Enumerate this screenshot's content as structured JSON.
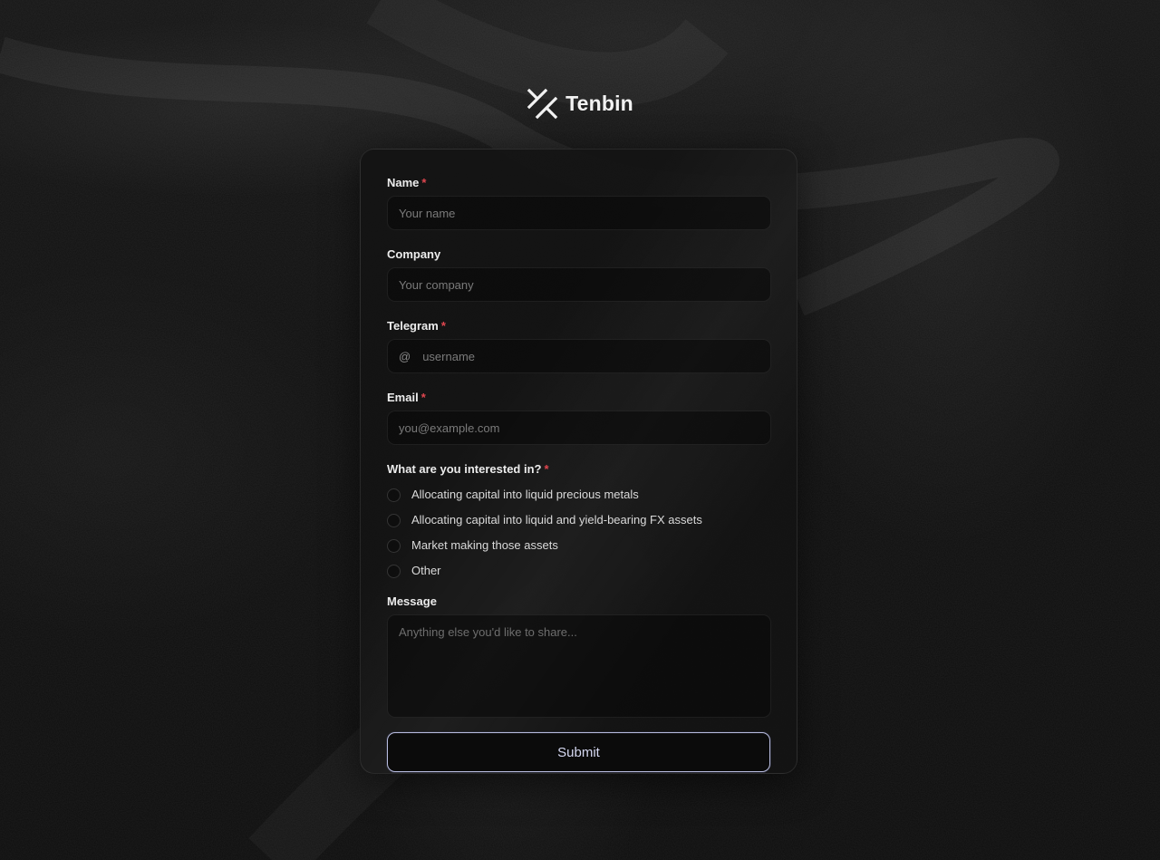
{
  "brand": {
    "name": "Tenbin",
    "logo_icon": "tenbin-slash-logo-icon"
  },
  "form": {
    "name": {
      "label": "Name",
      "required_mark": "*",
      "placeholder": "Your name"
    },
    "company": {
      "label": "Company",
      "placeholder": "Your company"
    },
    "telegram": {
      "label": "Telegram",
      "required_mark": "*",
      "prefix": "@",
      "placeholder": "username"
    },
    "email": {
      "label": "Email",
      "required_mark": "*",
      "placeholder": "you@example.com"
    },
    "interest": {
      "label": "What are you interested in?",
      "required_mark": "*",
      "options": [
        "Allocating capital into liquid precious metals",
        "Allocating capital into liquid and yield-bearing FX assets",
        "Market making those assets",
        "Other"
      ]
    },
    "message": {
      "label": "Message",
      "placeholder": "Anything else you'd like to share..."
    },
    "submit_label": "Submit"
  },
  "colors": {
    "background": "#0f0f0f",
    "required": "#e0464f",
    "submit_border": "#b9bde0"
  }
}
